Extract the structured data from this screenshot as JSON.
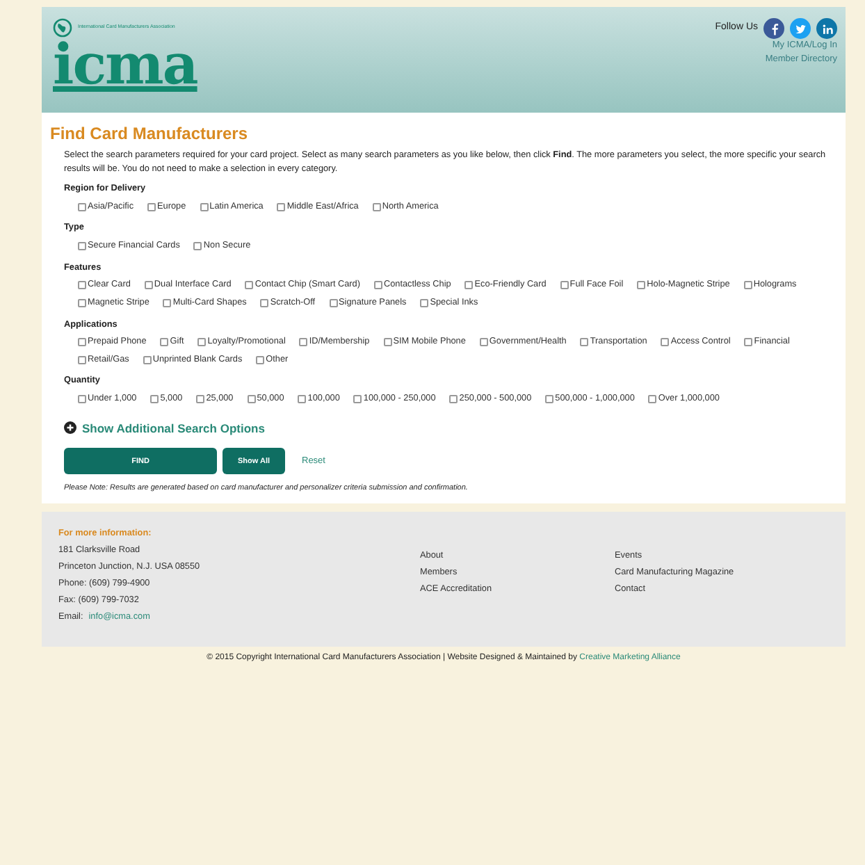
{
  "header": {
    "logo": "icma",
    "tagline": "International Card Manufacturers Association",
    "follow_label": "Follow Us",
    "social": [
      {
        "kind": "facebook",
        "color": "#3b5998"
      },
      {
        "kind": "twitter",
        "color": "#1da1f2"
      },
      {
        "kind": "linkedin",
        "color": "#0e76a8"
      }
    ],
    "links": [
      "My ICMA/Log In",
      "Member Directory"
    ]
  },
  "title": "Find Card Manufacturers",
  "intro": "Select the search parameters required for your card project. Select as many search parameters as you like below, then click **Find**. The more parameters you select, the more specific your search results will be. You do not need to make a selection in every category.",
  "groups": [
    {
      "label": "Region for Delivery",
      "options": [
        {
          "label": "Asia/Pacific",
          "checked": false
        },
        {
          "label": "Europe",
          "checked": false
        },
        {
          "label": "Latin America",
          "checked": false
        },
        {
          "label": "Middle East/Africa",
          "checked": false
        },
        {
          "label": "North America",
          "checked": false
        }
      ]
    },
    {
      "label": "Type",
      "options": [
        {
          "label": "Secure Financial Cards",
          "checked": false
        },
        {
          "label": "Non Secure",
          "checked": false
        }
      ]
    },
    {
      "label": "Features",
      "options": [
        {
          "label": "Clear Card",
          "checked": false
        },
        {
          "label": "Dual Interface Card",
          "checked": false
        },
        {
          "label": "Contact Chip (Smart Card)",
          "checked": false
        },
        {
          "label": "Contactless Chip",
          "checked": false
        },
        {
          "label": "Eco-Friendly Card",
          "checked": false
        },
        {
          "label": "Full Face Foil",
          "checked": false
        },
        {
          "label": "Holo-Magnetic Stripe",
          "checked": false
        },
        {
          "label": "Holograms",
          "checked": false
        },
        {
          "label": "Magnetic Stripe",
          "checked": false
        },
        {
          "label": "Multi-Card Shapes",
          "checked": false
        },
        {
          "label": "Scratch-Off",
          "checked": false
        },
        {
          "label": "Signature Panels",
          "checked": false
        },
        {
          "label": "Special Inks",
          "checked": false
        }
      ]
    },
    {
      "label": "Applications",
      "options": [
        {
          "label": "Prepaid Phone",
          "checked": false
        },
        {
          "label": "Gift",
          "checked": false
        },
        {
          "label": "Loyalty/Promotional",
          "checked": false
        },
        {
          "label": "ID/Membership",
          "checked": false
        },
        {
          "label": "SIM Mobile Phone",
          "checked": false
        },
        {
          "label": "Government/Health",
          "checked": false
        },
        {
          "label": "Transportation",
          "checked": false
        },
        {
          "label": "Access Control",
          "checked": false
        },
        {
          "label": "Financial",
          "checked": false
        },
        {
          "label": "Retail/Gas",
          "checked": false
        },
        {
          "label": "Unprinted Blank Cards",
          "checked": false
        },
        {
          "label": "Other",
          "checked": false
        }
      ]
    },
    {
      "label": "Quantity",
      "options": [
        {
          "label": "Under 1,000",
          "checked": false
        },
        {
          "label": "5,000",
          "checked": false
        },
        {
          "label": "25,000",
          "checked": false
        },
        {
          "label": "50,000",
          "checked": false
        },
        {
          "label": "100,000",
          "checked": false
        },
        {
          "label": "100,000 - 250,000",
          "checked": false
        },
        {
          "label": "250,000 - 500,000",
          "checked": false
        },
        {
          "label": "500,000 - 1,000,000",
          "checked": false
        },
        {
          "label": "Over 1,000,000",
          "checked": false
        }
      ]
    }
  ],
  "more_options": "Show Additional Search Options",
  "buttons": [
    {
      "label": "FIND",
      "kind": "primary"
    },
    {
      "label": "Show All",
      "kind": "secondary"
    },
    {
      "label": "Reset",
      "kind": "link"
    }
  ],
  "note": "Please Note: Results are generated based on card manufacturer and personalizer criteria submission and confirmation.",
  "footer": {
    "heading": "For more information:",
    "address": [
      "181 Clarksville Road",
      "Princeton Junction, N.J. USA 08550",
      "Phone: (609) 799-4900",
      "Fax: (609) 799-7032"
    ],
    "email_label": "Email:",
    "email": "info@icma.com",
    "links_1": [
      "About",
      "Members",
      "ACE Accreditation"
    ],
    "links_2": [
      "Events",
      "Card Manufacturing Magazine",
      "Contact"
    ]
  },
  "copyright": "© 2015 Copyright International Card Manufacturers Association | Website Designed & Maintained by",
  "credit": "Creative Marketing Alliance"
}
